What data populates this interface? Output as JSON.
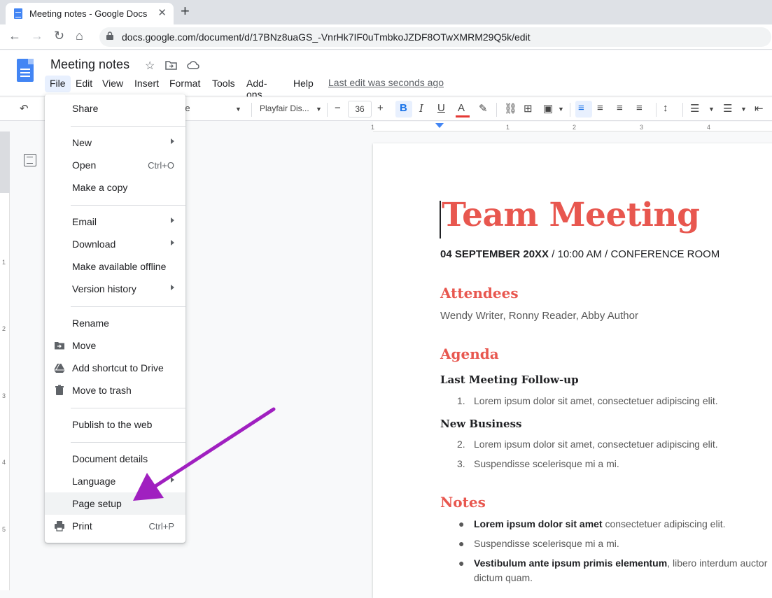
{
  "browser": {
    "tab_title": "Meeting notes - Google Docs",
    "url": "docs.google.com/document/d/17BNz8uaGS_-VnrHk7IF0uTmbkoJZDF8OTwXMRM29Q5k/edit"
  },
  "docs": {
    "title": "Meeting notes",
    "menu": [
      "File",
      "Edit",
      "View",
      "Insert",
      "Format",
      "Tools",
      "Add-ons",
      "Help"
    ],
    "last_edit": "Last edit was seconds ago"
  },
  "toolbar": {
    "style": "itle",
    "font": "Playfair Dis...",
    "font_size": "36"
  },
  "ruler": {
    "ticks": [
      "1",
      "1",
      "2",
      "3",
      "4"
    ],
    "vticks": [
      "1",
      "2",
      "3",
      "4",
      "5"
    ]
  },
  "file_menu": {
    "items": [
      {
        "label": "Share",
        "shortcut": "",
        "submenu": false,
        "icon": ""
      },
      {
        "label": "New",
        "shortcut": "",
        "submenu": true,
        "icon": ""
      },
      {
        "label": "Open",
        "shortcut": "Ctrl+O",
        "submenu": false,
        "icon": ""
      },
      {
        "label": "Make a copy",
        "shortcut": "",
        "submenu": false,
        "icon": ""
      },
      {
        "label": "Email",
        "shortcut": "",
        "submenu": true,
        "icon": ""
      },
      {
        "label": "Download",
        "shortcut": "",
        "submenu": true,
        "icon": ""
      },
      {
        "label": "Make available offline",
        "shortcut": "",
        "submenu": false,
        "icon": ""
      },
      {
        "label": "Version history",
        "shortcut": "",
        "submenu": true,
        "icon": ""
      },
      {
        "label": "Rename",
        "shortcut": "",
        "submenu": false,
        "icon": ""
      },
      {
        "label": "Move",
        "shortcut": "",
        "submenu": false,
        "icon": "move-to-folder-icon"
      },
      {
        "label": "Add shortcut to Drive",
        "shortcut": "",
        "submenu": false,
        "icon": "drive-shortcut-icon"
      },
      {
        "label": "Move to trash",
        "shortcut": "",
        "submenu": false,
        "icon": "trash-icon"
      },
      {
        "label": "Publish to the web",
        "shortcut": "",
        "submenu": false,
        "icon": ""
      },
      {
        "label": "Document details",
        "shortcut": "",
        "submenu": false,
        "icon": ""
      },
      {
        "label": "Language",
        "shortcut": "",
        "submenu": true,
        "icon": ""
      },
      {
        "label": "Page setup",
        "shortcut": "",
        "submenu": false,
        "icon": ""
      },
      {
        "label": "Print",
        "shortcut": "Ctrl+P",
        "submenu": false,
        "icon": "print-icon"
      }
    ],
    "highlighted": "Page setup"
  },
  "document": {
    "heading": "Team Meeting",
    "date_bold": "04 SEPTEMBER 20XX",
    "date_rest": " / 10:00 AM / CONFERENCE ROOM",
    "attendees_heading": "Attendees",
    "attendees": "Wendy Writer, Ronny Reader, Abby Author",
    "agenda_heading": "Agenda",
    "followup_heading": "Last Meeting Follow-up",
    "followup_items": [
      {
        "num": "1.",
        "text": "Lorem ipsum dolor sit amet, consectetuer adipiscing elit."
      }
    ],
    "newbiz_heading": "New Business",
    "newbiz_items": [
      {
        "num": "2.",
        "text": "Lorem ipsum dolor sit amet, consectetuer adipiscing elit."
      },
      {
        "num": "3.",
        "text": "Suspendisse scelerisque mi a mi."
      }
    ],
    "notes_heading": "Notes",
    "notes": [
      {
        "bold": "Lorem ipsum dolor sit amet",
        "rest": " consectetuer adipiscing elit."
      },
      {
        "bold": "",
        "rest": "Suspendisse scelerisque mi a mi."
      },
      {
        "bold": "Vestibulum ante ipsum primis elementum",
        "rest": ", libero interdum auctor"
      }
    ],
    "notes_continuation": "dictum quam."
  },
  "colors": {
    "accent": "#e8574f",
    "annotation_arrow": "#a020c0",
    "docs_blue": "#4285f4"
  }
}
